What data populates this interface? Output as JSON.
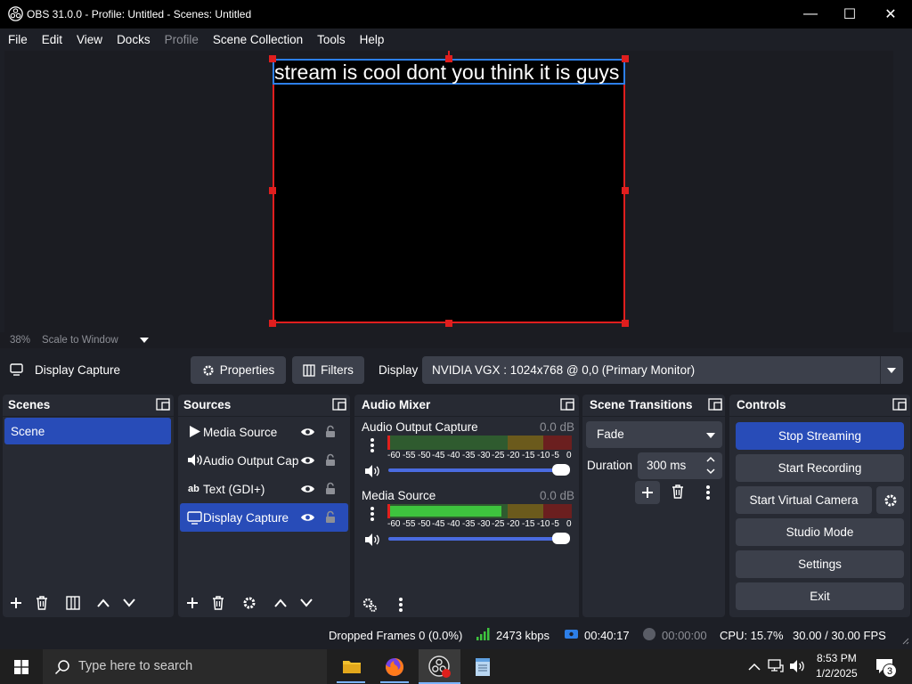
{
  "window": {
    "title": "OBS 31.0.0 - Profile: Untitled - Scenes: Untitled",
    "minimize": "—",
    "maximize": "☐",
    "close": "✕"
  },
  "menu": [
    "File",
    "Edit",
    "View",
    "Docks",
    "Profile",
    "Scene Collection",
    "Tools",
    "Help"
  ],
  "preview": {
    "overlay_text": "stream is cool dont you think it is guys",
    "zoom": "38%",
    "zoom_mode": "Scale to Window"
  },
  "source_toolbar": {
    "selected_source": "Display Capture",
    "properties_label": "Properties",
    "filters_label": "Filters",
    "display_label": "Display",
    "display_value": "NVIDIA VGX : 1024x768 @ 0,0 (Primary Monitor)"
  },
  "scenes": {
    "title": "Scenes",
    "items": [
      "Scene"
    ]
  },
  "sources": {
    "title": "Sources",
    "items": [
      {
        "name": "Media Source",
        "icon": "play-icon"
      },
      {
        "name": "Audio Output Cap",
        "icon": "speaker-icon"
      },
      {
        "name": "Text (GDI+)",
        "icon": "text-ab-icon"
      },
      {
        "name": "Display Capture",
        "icon": "monitor-icon"
      }
    ]
  },
  "audio_mixer": {
    "title": "Audio Mixer",
    "channels": [
      {
        "name": "Audio Output Capture",
        "db": "0.0 dB",
        "level": 0.0
      },
      {
        "name": "Media Source",
        "db": "0.0 dB",
        "level": 0.62
      }
    ],
    "scale": [
      "-60",
      "-55",
      "-50",
      "-45",
      "-40",
      "-35",
      "-30",
      "-25",
      "-20",
      "-15",
      "-10",
      "-5",
      "0"
    ]
  },
  "scene_transitions": {
    "title": "Scene Transitions",
    "transition": "Fade",
    "duration_label": "Duration",
    "duration_value": "300 ms"
  },
  "controls": {
    "title": "Controls",
    "stop_streaming": "Stop Streaming",
    "start_recording": "Start Recording",
    "start_virtual_camera": "Start Virtual Camera",
    "studio_mode": "Studio Mode",
    "settings": "Settings",
    "exit": "Exit"
  },
  "status": {
    "dropped_frames": "Dropped Frames 0 (0.0%)",
    "bitrate": "2473 kbps",
    "stream_time": "00:40:17",
    "record_time": "00:00:00",
    "cpu": "CPU: 15.7%",
    "fps": "30.00 / 30.00 FPS"
  },
  "taskbar": {
    "search_placeholder": "Type here to search",
    "time": "8:53 PM",
    "date": "1/2/2025",
    "notification_count": "3"
  },
  "colors": {
    "accent_blue": "#284cb8",
    "selection_red": "#e01e1e",
    "text_source_border": "#2d7fe8"
  }
}
